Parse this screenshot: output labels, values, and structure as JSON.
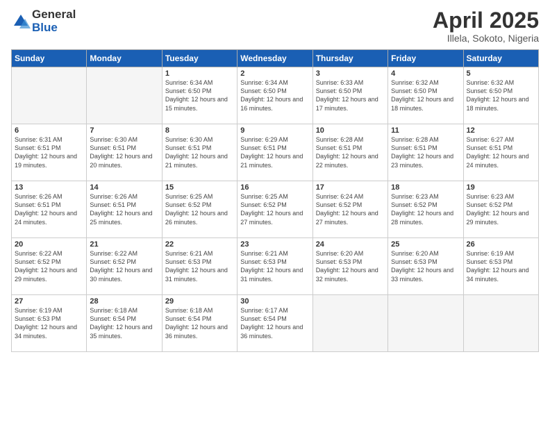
{
  "header": {
    "logo_general": "General",
    "logo_blue": "Blue",
    "month_title": "April 2025",
    "subtitle": "Illela, Sokoto, Nigeria"
  },
  "days_of_week": [
    "Sunday",
    "Monday",
    "Tuesday",
    "Wednesday",
    "Thursday",
    "Friday",
    "Saturday"
  ],
  "weeks": [
    [
      {
        "num": "",
        "sunrise": "",
        "sunset": "",
        "daylight": ""
      },
      {
        "num": "",
        "sunrise": "",
        "sunset": "",
        "daylight": ""
      },
      {
        "num": "1",
        "sunrise": "Sunrise: 6:34 AM",
        "sunset": "Sunset: 6:50 PM",
        "daylight": "Daylight: 12 hours and 15 minutes."
      },
      {
        "num": "2",
        "sunrise": "Sunrise: 6:34 AM",
        "sunset": "Sunset: 6:50 PM",
        "daylight": "Daylight: 12 hours and 16 minutes."
      },
      {
        "num": "3",
        "sunrise": "Sunrise: 6:33 AM",
        "sunset": "Sunset: 6:50 PM",
        "daylight": "Daylight: 12 hours and 17 minutes."
      },
      {
        "num": "4",
        "sunrise": "Sunrise: 6:32 AM",
        "sunset": "Sunset: 6:50 PM",
        "daylight": "Daylight: 12 hours and 18 minutes."
      },
      {
        "num": "5",
        "sunrise": "Sunrise: 6:32 AM",
        "sunset": "Sunset: 6:50 PM",
        "daylight": "Daylight: 12 hours and 18 minutes."
      }
    ],
    [
      {
        "num": "6",
        "sunrise": "Sunrise: 6:31 AM",
        "sunset": "Sunset: 6:51 PM",
        "daylight": "Daylight: 12 hours and 19 minutes."
      },
      {
        "num": "7",
        "sunrise": "Sunrise: 6:30 AM",
        "sunset": "Sunset: 6:51 PM",
        "daylight": "Daylight: 12 hours and 20 minutes."
      },
      {
        "num": "8",
        "sunrise": "Sunrise: 6:30 AM",
        "sunset": "Sunset: 6:51 PM",
        "daylight": "Daylight: 12 hours and 21 minutes."
      },
      {
        "num": "9",
        "sunrise": "Sunrise: 6:29 AM",
        "sunset": "Sunset: 6:51 PM",
        "daylight": "Daylight: 12 hours and 21 minutes."
      },
      {
        "num": "10",
        "sunrise": "Sunrise: 6:28 AM",
        "sunset": "Sunset: 6:51 PM",
        "daylight": "Daylight: 12 hours and 22 minutes."
      },
      {
        "num": "11",
        "sunrise": "Sunrise: 6:28 AM",
        "sunset": "Sunset: 6:51 PM",
        "daylight": "Daylight: 12 hours and 23 minutes."
      },
      {
        "num": "12",
        "sunrise": "Sunrise: 6:27 AM",
        "sunset": "Sunset: 6:51 PM",
        "daylight": "Daylight: 12 hours and 24 minutes."
      }
    ],
    [
      {
        "num": "13",
        "sunrise": "Sunrise: 6:26 AM",
        "sunset": "Sunset: 6:51 PM",
        "daylight": "Daylight: 12 hours and 24 minutes."
      },
      {
        "num": "14",
        "sunrise": "Sunrise: 6:26 AM",
        "sunset": "Sunset: 6:51 PM",
        "daylight": "Daylight: 12 hours and 25 minutes."
      },
      {
        "num": "15",
        "sunrise": "Sunrise: 6:25 AM",
        "sunset": "Sunset: 6:52 PM",
        "daylight": "Daylight: 12 hours and 26 minutes."
      },
      {
        "num": "16",
        "sunrise": "Sunrise: 6:25 AM",
        "sunset": "Sunset: 6:52 PM",
        "daylight": "Daylight: 12 hours and 27 minutes."
      },
      {
        "num": "17",
        "sunrise": "Sunrise: 6:24 AM",
        "sunset": "Sunset: 6:52 PM",
        "daylight": "Daylight: 12 hours and 27 minutes."
      },
      {
        "num": "18",
        "sunrise": "Sunrise: 6:23 AM",
        "sunset": "Sunset: 6:52 PM",
        "daylight": "Daylight: 12 hours and 28 minutes."
      },
      {
        "num": "19",
        "sunrise": "Sunrise: 6:23 AM",
        "sunset": "Sunset: 6:52 PM",
        "daylight": "Daylight: 12 hours and 29 minutes."
      }
    ],
    [
      {
        "num": "20",
        "sunrise": "Sunrise: 6:22 AM",
        "sunset": "Sunset: 6:52 PM",
        "daylight": "Daylight: 12 hours and 29 minutes."
      },
      {
        "num": "21",
        "sunrise": "Sunrise: 6:22 AM",
        "sunset": "Sunset: 6:52 PM",
        "daylight": "Daylight: 12 hours and 30 minutes."
      },
      {
        "num": "22",
        "sunrise": "Sunrise: 6:21 AM",
        "sunset": "Sunset: 6:53 PM",
        "daylight": "Daylight: 12 hours and 31 minutes."
      },
      {
        "num": "23",
        "sunrise": "Sunrise: 6:21 AM",
        "sunset": "Sunset: 6:53 PM",
        "daylight": "Daylight: 12 hours and 31 minutes."
      },
      {
        "num": "24",
        "sunrise": "Sunrise: 6:20 AM",
        "sunset": "Sunset: 6:53 PM",
        "daylight": "Daylight: 12 hours and 32 minutes."
      },
      {
        "num": "25",
        "sunrise": "Sunrise: 6:20 AM",
        "sunset": "Sunset: 6:53 PM",
        "daylight": "Daylight: 12 hours and 33 minutes."
      },
      {
        "num": "26",
        "sunrise": "Sunrise: 6:19 AM",
        "sunset": "Sunset: 6:53 PM",
        "daylight": "Daylight: 12 hours and 34 minutes."
      }
    ],
    [
      {
        "num": "27",
        "sunrise": "Sunrise: 6:19 AM",
        "sunset": "Sunset: 6:53 PM",
        "daylight": "Daylight: 12 hours and 34 minutes."
      },
      {
        "num": "28",
        "sunrise": "Sunrise: 6:18 AM",
        "sunset": "Sunset: 6:54 PM",
        "daylight": "Daylight: 12 hours and 35 minutes."
      },
      {
        "num": "29",
        "sunrise": "Sunrise: 6:18 AM",
        "sunset": "Sunset: 6:54 PM",
        "daylight": "Daylight: 12 hours and 36 minutes."
      },
      {
        "num": "30",
        "sunrise": "Sunrise: 6:17 AM",
        "sunset": "Sunset: 6:54 PM",
        "daylight": "Daylight: 12 hours and 36 minutes."
      },
      {
        "num": "",
        "sunrise": "",
        "sunset": "",
        "daylight": ""
      },
      {
        "num": "",
        "sunrise": "",
        "sunset": "",
        "daylight": ""
      },
      {
        "num": "",
        "sunrise": "",
        "sunset": "",
        "daylight": ""
      }
    ]
  ]
}
